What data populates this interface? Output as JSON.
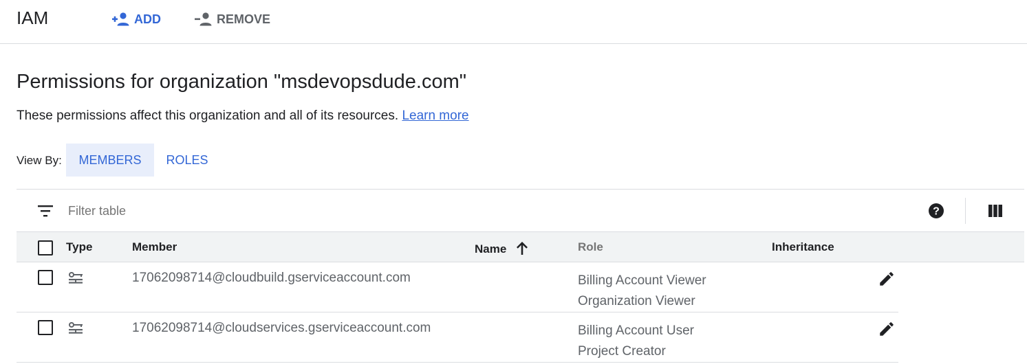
{
  "header": {
    "title": "IAM",
    "add_label": "ADD",
    "remove_label": "REMOVE"
  },
  "page": {
    "title": "Permissions for organization \"msdevopsdude.com\"",
    "subtitle": "These permissions affect this organization and all of its resources.",
    "learn_more": "Learn more"
  },
  "view_by": {
    "label": "View By:",
    "tabs": [
      {
        "label": "MEMBERS",
        "selected": true
      },
      {
        "label": "ROLES",
        "selected": false
      }
    ]
  },
  "table": {
    "filter_placeholder": "Filter table",
    "columns": {
      "type": "Type",
      "member": "Member",
      "name": "Name",
      "role": "Role",
      "inheritance": "Inheritance"
    },
    "sort": {
      "column": "Name",
      "direction": "ascending"
    },
    "rows": [
      {
        "type_icon": "service-account-icon",
        "member": "17062098714@cloudbuild.gserviceaccount.com",
        "name": "",
        "roles": [
          "Billing Account Viewer",
          "Organization Viewer"
        ]
      },
      {
        "type_icon": "service-account-icon",
        "member": "17062098714@cloudservices.gserviceaccount.com",
        "name": "",
        "roles": [
          "Billing Account User",
          "Project Creator"
        ]
      }
    ]
  },
  "colors": {
    "accent": "#3367d6",
    "selected_tab_bg": "#e8eefb",
    "header_bg": "#f1f3f4",
    "divider": "#dadce0",
    "secondary_text": "#5f6368"
  }
}
